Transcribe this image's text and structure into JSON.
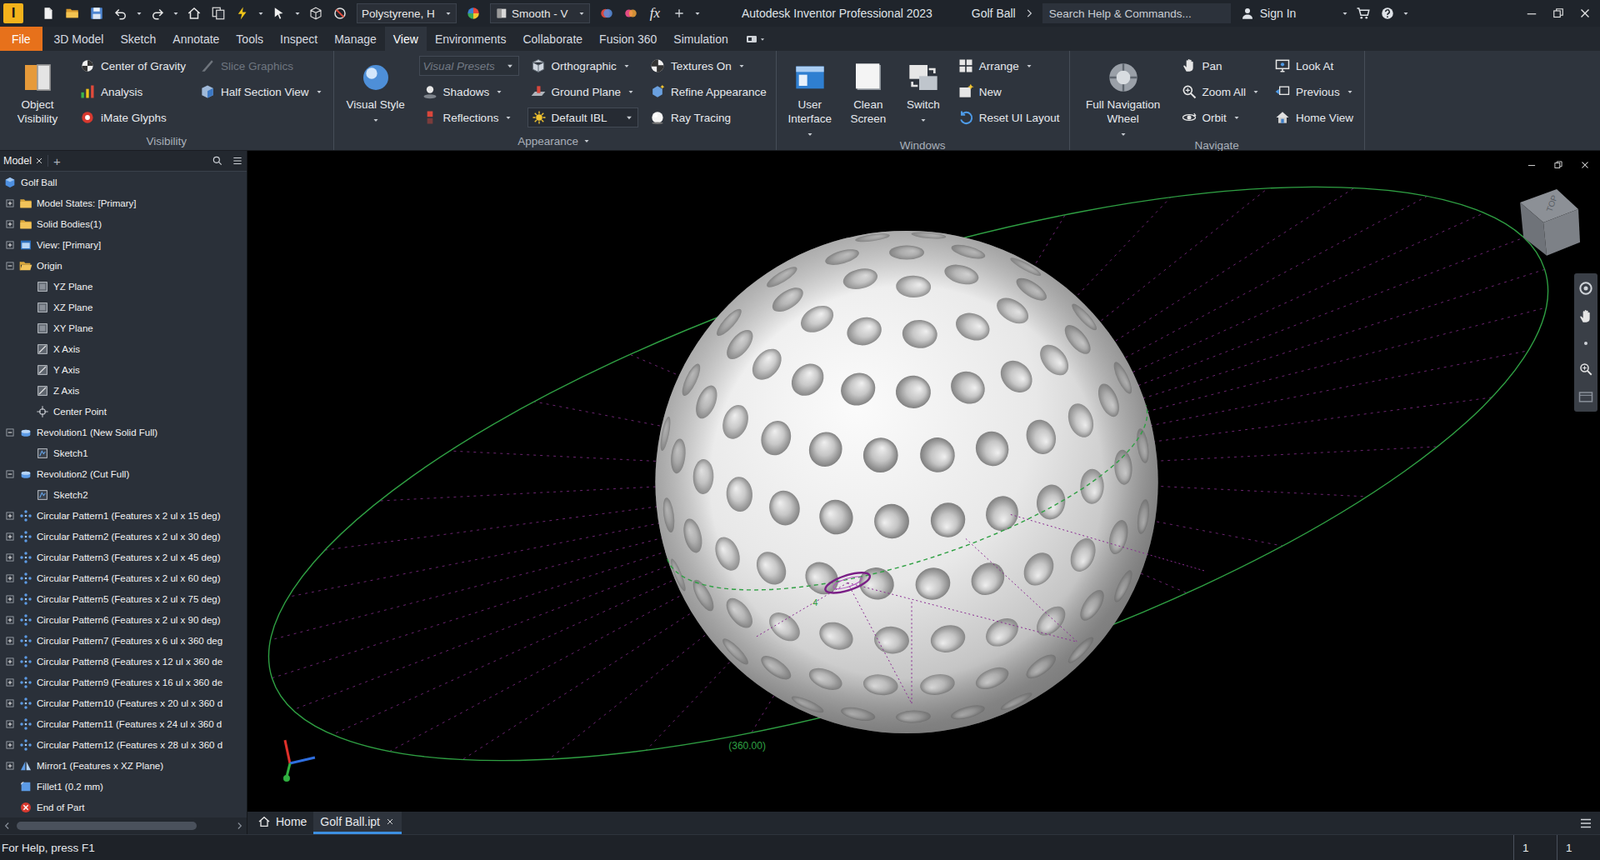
{
  "window": {
    "logo": "I",
    "title": "Autodesk Inventor Professional 2023",
    "document": "Golf Ball"
  },
  "quick_access": {
    "material": "Polystyrene, H",
    "appearance": "Smooth - V",
    "formula": "fx"
  },
  "search": {
    "placeholder": "Search Help & Commands..."
  },
  "account": {
    "label": "Sign In"
  },
  "ribbon_tabs": [
    {
      "label": "File",
      "selected": false,
      "kind": "file"
    },
    {
      "label": "3D Model",
      "selected": false,
      "kind": "tab"
    },
    {
      "label": "Sketch",
      "selected": false,
      "kind": "tab"
    },
    {
      "label": "Annotate",
      "selected": false,
      "kind": "tab"
    },
    {
      "label": "Tools",
      "selected": false,
      "kind": "tab"
    },
    {
      "label": "Inspect",
      "selected": false,
      "kind": "tab"
    },
    {
      "label": "Manage",
      "selected": false,
      "kind": "tab"
    },
    {
      "label": "View",
      "selected": true,
      "kind": "tab"
    },
    {
      "label": "Environments",
      "selected": false,
      "kind": "tab"
    },
    {
      "label": "Collaborate",
      "selected": false,
      "kind": "tab"
    },
    {
      "label": "Fusion 360",
      "selected": false,
      "kind": "tab"
    },
    {
      "label": "Simulation",
      "selected": false,
      "kind": "tab"
    }
  ],
  "ribbon_panels": [
    {
      "title": "Visibility",
      "menu": false,
      "columns": [
        [
          {
            "label": "Object Visibility",
            "kind": "large",
            "dropdown": false,
            "disabled": false
          }
        ],
        [
          {
            "label": "Center of Gravity",
            "kind": "small",
            "dropdown": false,
            "disabled": false
          },
          {
            "label": "Analysis",
            "kind": "small",
            "dropdown": false,
            "disabled": false
          },
          {
            "label": "iMate Glyphs",
            "kind": "small",
            "dropdown": false,
            "disabled": false
          }
        ],
        [
          {
            "label": "Slice Graphics",
            "kind": "small",
            "dropdown": false,
            "disabled": true
          },
          {
            "label": "Half Section View",
            "kind": "small",
            "dropdown": true,
            "disabled": false
          }
        ]
      ]
    },
    {
      "title": "Appearance",
      "menu": true,
      "columns": [
        [
          {
            "label": "Visual Style",
            "kind": "large",
            "dropdown": true,
            "disabled": false
          }
        ],
        [
          {
            "label": "Visual Presets",
            "kind": "combo",
            "dropdown": true,
            "disabled": true
          },
          {
            "label": "Shadows",
            "kind": "small",
            "dropdown": true,
            "disabled": false
          },
          {
            "label": "Reflections",
            "kind": "small",
            "dropdown": true,
            "disabled": false
          }
        ],
        [
          {
            "label": "Orthographic",
            "kind": "small",
            "dropdown": true,
            "disabled": false
          },
          {
            "label": "Ground Plane",
            "kind": "small",
            "dropdown": true,
            "disabled": false
          },
          {
            "label": "Default IBL",
            "kind": "combo",
            "dropdown": true,
            "disabled": false
          }
        ],
        [
          {
            "label": "Textures On",
            "kind": "small",
            "dropdown": true,
            "disabled": false
          },
          {
            "label": "Refine Appearance",
            "kind": "small",
            "dropdown": false,
            "disabled": false
          },
          {
            "label": "Ray Tracing",
            "kind": "small",
            "dropdown": false,
            "disabled": false
          }
        ]
      ]
    },
    {
      "title": "Windows",
      "menu": false,
      "columns": [
        [
          {
            "label": "User Interface",
            "kind": "large",
            "dropdown": true,
            "disabled": false
          }
        ],
        [
          {
            "label": "Clean Screen",
            "kind": "large",
            "dropdown": false,
            "disabled": false
          }
        ],
        [
          {
            "label": "Switch",
            "kind": "large",
            "dropdown": true,
            "disabled": false
          }
        ],
        [
          {
            "label": "Arrange",
            "kind": "small",
            "dropdown": true,
            "disabled": false
          },
          {
            "label": "New",
            "kind": "small",
            "dropdown": false,
            "disabled": false
          },
          {
            "label": "Reset UI Layout",
            "kind": "small",
            "dropdown": false,
            "disabled": false
          }
        ]
      ]
    },
    {
      "title": "Navigate",
      "menu": false,
      "columns": [
        [
          {
            "label": "Full Navigation Wheel",
            "kind": "large",
            "dropdown": true,
            "disabled": false
          }
        ],
        [
          {
            "label": "Pan",
            "kind": "small",
            "dropdown": false,
            "disabled": false
          },
          {
            "label": "Zoom All",
            "kind": "small",
            "dropdown": true,
            "disabled": false
          },
          {
            "label": "Orbit",
            "kind": "small",
            "dropdown": true,
            "disabled": false
          }
        ],
        [
          {
            "label": "Look At",
            "kind": "small",
            "dropdown": false,
            "disabled": false
          },
          {
            "label": "Previous",
            "kind": "small",
            "dropdown": true,
            "disabled": false
          },
          {
            "label": "Home View",
            "kind": "small",
            "dropdown": false,
            "disabled": false
          }
        ]
      ]
    }
  ],
  "browser": {
    "tab": "Model",
    "add": "+",
    "items": [
      {
        "label": "Golf Ball",
        "depth": 0,
        "expanded": null,
        "kind": "root"
      },
      {
        "label": "Model States: [Primary]",
        "depth": 1,
        "expanded": false,
        "kind": "folder"
      },
      {
        "label": "Solid Bodies(1)",
        "depth": 1,
        "expanded": false,
        "kind": "folder"
      },
      {
        "label": "View: [Primary]",
        "depth": 1,
        "expanded": false,
        "kind": "view"
      },
      {
        "label": "Origin",
        "depth": 1,
        "expanded": true,
        "kind": "folder"
      },
      {
        "label": "YZ Plane",
        "depth": 2,
        "expanded": null,
        "kind": "plane"
      },
      {
        "label": "XZ Plane",
        "depth": 2,
        "expanded": null,
        "kind": "plane"
      },
      {
        "label": "XY Plane",
        "depth": 2,
        "expanded": null,
        "kind": "plane"
      },
      {
        "label": "X Axis",
        "depth": 2,
        "expanded": null,
        "kind": "axis"
      },
      {
        "label": "Y Axis",
        "depth": 2,
        "expanded": null,
        "kind": "axis"
      },
      {
        "label": "Z Axis",
        "depth": 2,
        "expanded": null,
        "kind": "axis"
      },
      {
        "label": "Center Point",
        "depth": 2,
        "expanded": null,
        "kind": "point"
      },
      {
        "label": "Revolution1 (New Solid Full)",
        "depth": 1,
        "expanded": true,
        "kind": "revolve"
      },
      {
        "label": "Sketch1",
        "depth": 2,
        "expanded": null,
        "kind": "sketch"
      },
      {
        "label": "Revolution2 (Cut Full)",
        "depth": 1,
        "expanded": true,
        "kind": "revolve"
      },
      {
        "label": "Sketch2",
        "depth": 2,
        "expanded": null,
        "kind": "sketch"
      },
      {
        "label": "Circular Pattern1 (Features x 2 ul x 15 deg)",
        "depth": 1,
        "expanded": false,
        "kind": "pattern"
      },
      {
        "label": "Circular Pattern2 (Features x 2 ul x 30 deg)",
        "depth": 1,
        "expanded": false,
        "kind": "pattern"
      },
      {
        "label": "Circular Pattern3 (Features x 2 ul x 45 deg)",
        "depth": 1,
        "expanded": false,
        "kind": "pattern"
      },
      {
        "label": "Circular Pattern4 (Features x 2 ul x 60 deg)",
        "depth": 1,
        "expanded": false,
        "kind": "pattern"
      },
      {
        "label": "Circular Pattern5 (Features x 2 ul x 75 deg)",
        "depth": 1,
        "expanded": false,
        "kind": "pattern"
      },
      {
        "label": "Circular Pattern6 (Features x 2 ul x 90 deg)",
        "depth": 1,
        "expanded": false,
        "kind": "pattern"
      },
      {
        "label": "Circular Pattern7 (Features x 6 ul x 360 deg",
        "depth": 1,
        "expanded": false,
        "kind": "pattern"
      },
      {
        "label": "Circular Pattern8 (Features x 12 ul x 360 de",
        "depth": 1,
        "expanded": false,
        "kind": "pattern"
      },
      {
        "label": "Circular Pattern9 (Features x 16 ul x 360 de",
        "depth": 1,
        "expanded": false,
        "kind": "pattern"
      },
      {
        "label": "Circular Pattern10 (Features x 20 ul x 360 d",
        "depth": 1,
        "expanded": false,
        "kind": "pattern"
      },
      {
        "label": "Circular Pattern11 (Features x 24 ul x 360 d",
        "depth": 1,
        "expanded": false,
        "kind": "pattern"
      },
      {
        "label": "Circular Pattern12 (Features x 28 ul x 360 d",
        "depth": 1,
        "expanded": false,
        "kind": "pattern"
      },
      {
        "label": "Mirror1 (Features x XZ Plane)",
        "depth": 1,
        "expanded": false,
        "kind": "mirror"
      },
      {
        "label": "Fillet1 (0.2 mm)",
        "depth": 1,
        "expanded": null,
        "kind": "fillet"
      },
      {
        "label": "End of Part",
        "depth": 1,
        "expanded": null,
        "kind": "end"
      }
    ]
  },
  "viewport": {
    "dimension": "(360.00)",
    "dimension_mark": "4",
    "viewcube_face": "TOP"
  },
  "document_tabs": [
    {
      "label": "Home",
      "selected": false,
      "closable": false
    },
    {
      "label": "Golf Ball.ipt",
      "selected": true,
      "closable": true
    }
  ],
  "status_bar": {
    "help": "For Help, press F1",
    "counters": [
      "1",
      "1"
    ]
  }
}
